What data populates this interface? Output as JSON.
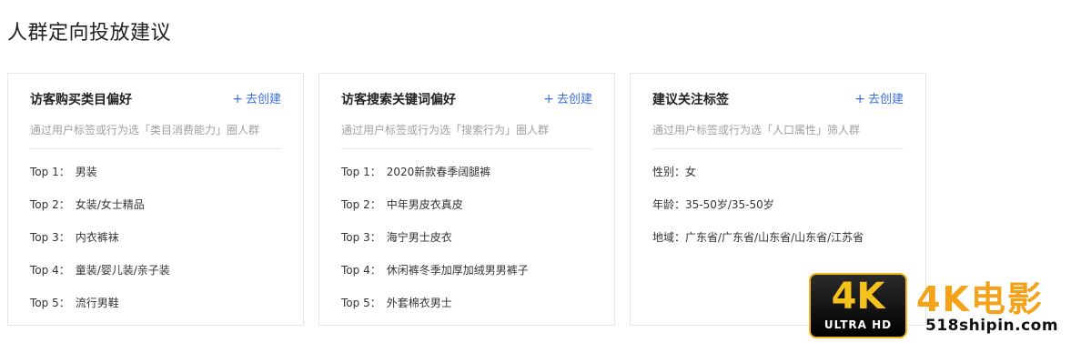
{
  "page": {
    "title": "人群定向投放建议"
  },
  "cards": [
    {
      "title": "访客购买类目偏好",
      "create_label": "去创建",
      "description": "通过用户标签或行为选「类目消费能力」圈人群",
      "items": [
        {
          "rank": "Top 1：",
          "value": "男装"
        },
        {
          "rank": "Top 2：",
          "value": "女装/女士精品"
        },
        {
          "rank": "Top 3：",
          "value": "内衣裤袜"
        },
        {
          "rank": "Top 4：",
          "value": "童装/婴儿装/亲子装"
        },
        {
          "rank": "Top 5：",
          "value": "流行男鞋"
        }
      ]
    },
    {
      "title": "访客搜索关键词偏好",
      "create_label": "去创建",
      "description": "通过用户标签或行为选「搜索行为」圈人群",
      "items": [
        {
          "rank": "Top 1：",
          "value": "2020新款春季阔腿裤"
        },
        {
          "rank": "Top 2：",
          "value": "中年男皮衣真皮"
        },
        {
          "rank": "Top 3：",
          "value": "海宁男士皮衣"
        },
        {
          "rank": "Top 4：",
          "value": "休闲裤冬季加厚加绒男男裤子"
        },
        {
          "rank": "Top 5：",
          "value": "外套棉衣男士"
        }
      ]
    },
    {
      "title": "建议关注标签",
      "create_label": "去创建",
      "description": "通过用户标签或行为选「人口属性」筛人群",
      "items": [
        {
          "rank": "",
          "value": "性别：女"
        },
        {
          "rank": "",
          "value": "年龄：35-50岁/35-50岁"
        },
        {
          "rank": "",
          "value": "地域：广东省/广东省/山东省/山东省/江苏省"
        }
      ]
    }
  ],
  "watermark": {
    "badge_main": "4K",
    "badge_sub": "ULTRA HD",
    "brand": "4K电影",
    "url": "518shipin.com"
  },
  "colors": {
    "link": "#3c6fd8",
    "watermark_gold": "#f5a21b"
  }
}
